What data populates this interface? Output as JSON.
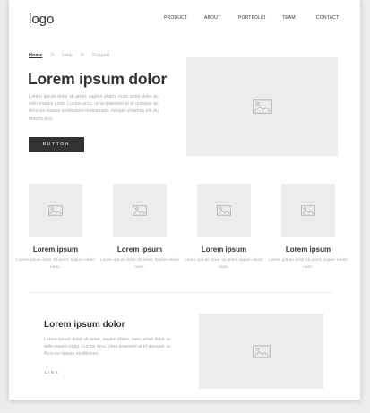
{
  "header": {
    "logo": "logo",
    "nav": [
      "PRODUCT",
      "ABOUT",
      "PORTFOLIO",
      "TEAM",
      "CONTACT"
    ]
  },
  "breadcrumb": {
    "items": [
      "Home",
      "Help",
      "Support"
    ],
    "separator": ">"
  },
  "hero": {
    "title": "Lorem ipsum dolor",
    "body": "Lorem ipsum dolor sit amet, sapien etiam, nunc amet dolor ac odio mauris justo. Luctus arcu, urna praesent at id quisque ac. Arcu es massa vestibulum malesuada, integer vivamus elit eu mauris eus.",
    "button_label": "BUTTON",
    "image_icon": "image-placeholder-icon"
  },
  "features": [
    {
      "title": "Lorem ipsum",
      "body": "Lorem ipsum dolor sit amet, sapien etiam nunc."
    },
    {
      "title": "Lorem ipsum",
      "body": "Lorem ipsum dolor sit amet, sapien etiam nunc."
    },
    {
      "title": "Lorem ipsum",
      "body": "Lorem ipsum dolor sit amet, sapien etiam nunc."
    },
    {
      "title": "Lorem ipsum",
      "body": "Lorem ipsum dolor sit amet, sapien etiam nunc."
    }
  ],
  "section": {
    "title": "Lorem ipsum dolor",
    "body": "Lorem ipsum dolor sit amet, sapien etiam, nunc amet dolor ac odio mauris justo. Luctus arcu, urna praesent at id quisque ac. Arcu es massa vestibulum.",
    "link_label": "LINK"
  },
  "colors": {
    "text_dark": "#333333",
    "text_muted": "#aaaaaa",
    "placeholder_bg": "#ececec",
    "button_bg": "#333333"
  }
}
